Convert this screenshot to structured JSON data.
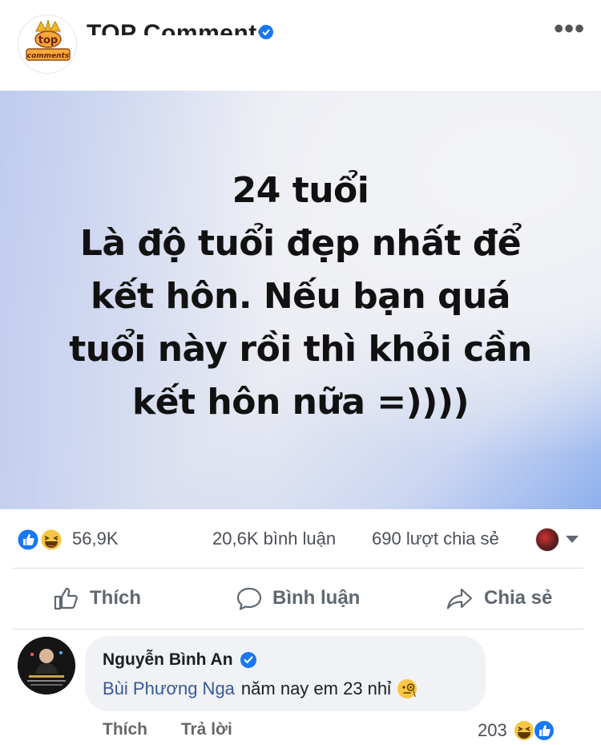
{
  "header": {
    "page_name": "TOP Comments",
    "avatar_badge_top": "top",
    "avatar_badge_bottom": "comments",
    "more_icon": "more-horizontal-icon"
  },
  "post": {
    "lines": [
      "24 tuổi",
      "Là độ tuổi đẹp nhất để",
      "kết hôn. Nếu bạn quá",
      "tuổi này rồi thì khỏi cần",
      "kết hôn nữa =))))"
    ]
  },
  "stats": {
    "reactions": "56,9K",
    "comments": "20,6K bình luận",
    "shares": "690 lượt chia sẻ"
  },
  "actions": {
    "like": "Thích",
    "comment": "Bình luận",
    "share": "Chia sẻ"
  },
  "comment": {
    "author": "Nguyễn Bình An",
    "mention": "Bùi Phương Nga",
    "text": "năm nay em 23 nhỉ",
    "like_label": "Thích",
    "reply_label": "Trả lời",
    "reaction_count": "203"
  },
  "colors": {
    "facebook_blue": "#1877f2",
    "mention_blue": "#385898",
    "laugh_yellow": "#f7c744"
  }
}
